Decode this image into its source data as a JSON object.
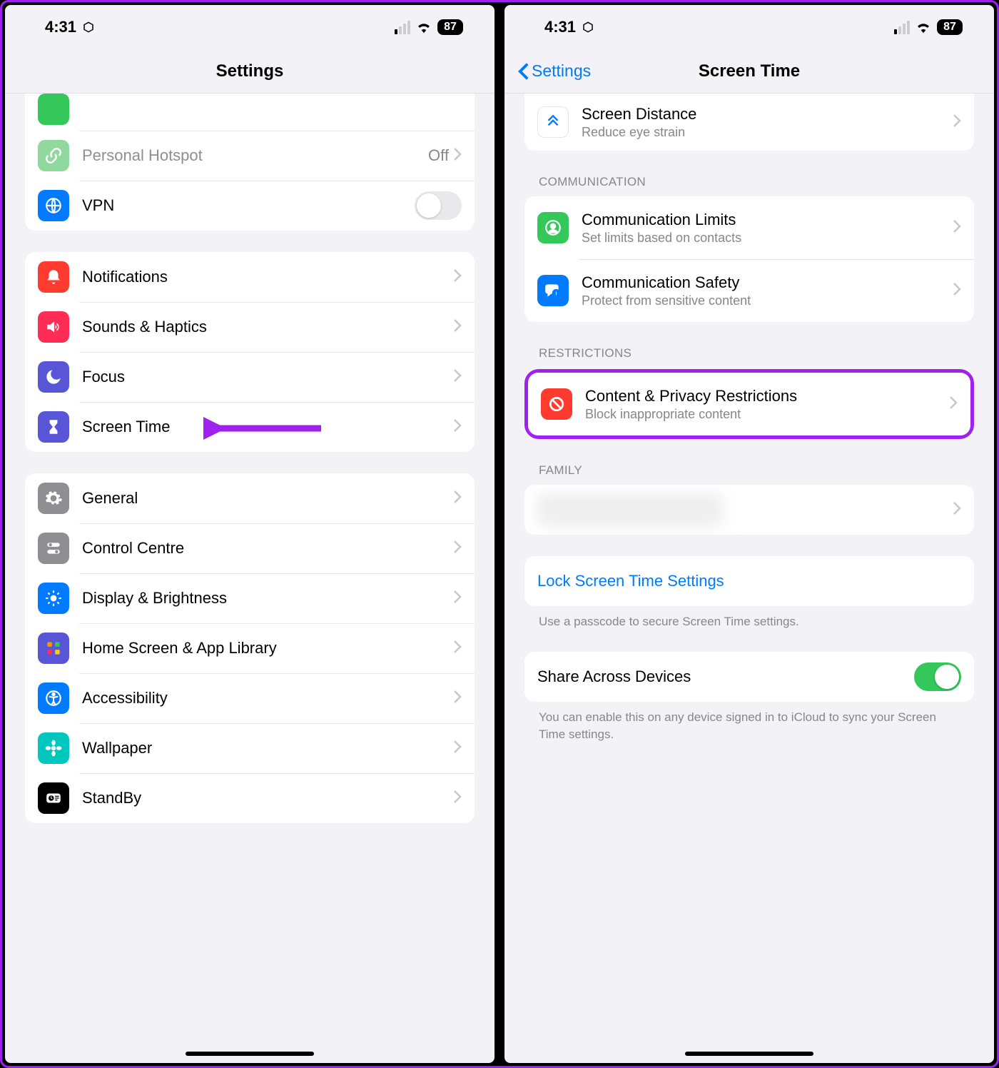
{
  "status": {
    "time": "4:31",
    "battery": "87"
  },
  "left": {
    "title": "Settings",
    "rows": {
      "hotspot": {
        "label": "Personal Hotspot",
        "value": "Off"
      },
      "vpn": {
        "label": "VPN"
      },
      "notifications": {
        "label": "Notifications"
      },
      "sounds": {
        "label": "Sounds & Haptics"
      },
      "focus": {
        "label": "Focus"
      },
      "screentime": {
        "label": "Screen Time"
      },
      "general": {
        "label": "General"
      },
      "control": {
        "label": "Control Centre"
      },
      "display": {
        "label": "Display & Brightness"
      },
      "home": {
        "label": "Home Screen & App Library"
      },
      "accessibility": {
        "label": "Accessibility"
      },
      "wallpaper": {
        "label": "Wallpaper"
      },
      "standby": {
        "label": "StandBy"
      }
    }
  },
  "right": {
    "back": "Settings",
    "title": "Screen Time",
    "screen_distance": {
      "label": "Screen Distance",
      "sub": "Reduce eye strain"
    },
    "sections": {
      "communication": {
        "header": "Communication",
        "limits": {
          "label": "Communication Limits",
          "sub": "Set limits based on contacts"
        },
        "safety": {
          "label": "Communication Safety",
          "sub": "Protect from sensitive content"
        }
      },
      "restrictions": {
        "header": "Restrictions",
        "content": {
          "label": "Content & Privacy Restrictions",
          "sub": "Block inappropriate content"
        }
      },
      "family": {
        "header": "Family"
      },
      "lock": {
        "label": "Lock Screen Time Settings",
        "footer": "Use a passcode to secure Screen Time settings."
      },
      "share": {
        "label": "Share Across Devices",
        "footer": "You can enable this on any device signed in to iCloud to sync your Screen Time settings."
      }
    }
  }
}
